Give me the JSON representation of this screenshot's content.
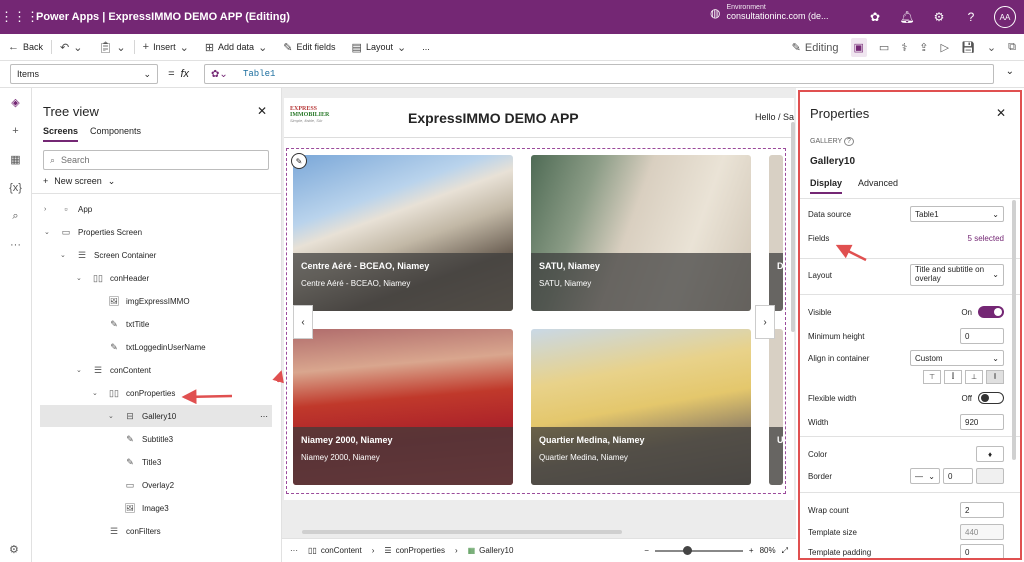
{
  "topbar": {
    "title": "Power Apps | ExpressIMMO DEMO APP (Editing)",
    "env_label": "Environment",
    "env_name": "consultationinc.com (de...",
    "avatar": "AA"
  },
  "cmdbar": {
    "back": "Back",
    "insert": "Insert",
    "add_data": "Add data",
    "edit_fields": "Edit fields",
    "layout": "Layout",
    "more": "...",
    "editing": "Editing"
  },
  "formula": {
    "property": "Items",
    "fx": "fx",
    "value": "Table1"
  },
  "tree": {
    "title": "Tree view",
    "tabs": [
      "Screens",
      "Components"
    ],
    "search_placeholder": "Search",
    "new_screen": "New screen",
    "nodes": [
      {
        "label": "App"
      },
      {
        "label": "Properties Screen"
      },
      {
        "label": "Screen Container"
      },
      {
        "label": "conHeader"
      },
      {
        "label": "imgExpressIMMO"
      },
      {
        "label": "txtTitle"
      },
      {
        "label": "txtLoggedinUserName"
      },
      {
        "label": "conContent"
      },
      {
        "label": "conProperties"
      },
      {
        "label": "Gallery10"
      },
      {
        "label": "Subtitle3"
      },
      {
        "label": "Title3"
      },
      {
        "label": "Overlay2"
      },
      {
        "label": "Image3"
      },
      {
        "label": "conFilters"
      }
    ]
  },
  "canvas": {
    "logo_line1": "EXPRESS",
    "logo_line2": "IMMOBILIER",
    "logo_tagline": "Simple, fiable, Sûr",
    "app_title": "ExpressIMMO DEMO APP",
    "hello": "Hello / Sa",
    "cards": [
      {
        "title": "Centre Aéré - BCEAO, Niamey",
        "subtitle": "Centre Aéré - BCEAO, Niamey"
      },
      {
        "title": "SATU, Niamey",
        "subtitle": "SATU, Niamey"
      },
      {
        "title": "Niamey 2000, Niamey",
        "subtitle": "Niamey 2000, Niamey"
      },
      {
        "title": "Quartier Medina, Niamey",
        "subtitle": "Quartier Medina, Niamey"
      }
    ],
    "peek_letters": [
      "D",
      "U"
    ]
  },
  "status": {
    "crumbs": [
      "conContent",
      "conProperties",
      "Gallery10"
    ],
    "zoom": "80%",
    "zoom_value": 0.8
  },
  "props": {
    "title": "Properties",
    "type": "GALLERY",
    "name": "Gallery10",
    "tabs": [
      "Display",
      "Advanced"
    ],
    "data_source_label": "Data source",
    "data_source": "Table1",
    "fields_label": "Fields",
    "fields_value": "5 selected",
    "layout_label": "Layout",
    "layout_value": "Title and subtitle on overlay",
    "visible_label": "Visible",
    "visible_value": "On",
    "min_height_label": "Minimum height",
    "min_height": "0",
    "align_label": "Align in container",
    "align_value": "Custom",
    "flex_width_label": "Flexible width",
    "flex_width_value": "Off",
    "width_label": "Width",
    "width": "920",
    "color_label": "Color",
    "border_label": "Border",
    "border_value": "0",
    "wrap_label": "Wrap count",
    "wrap": "2",
    "template_size_label": "Template size",
    "template_size": "440",
    "template_padding_label": "Template padding",
    "template_padding": "0"
  },
  "colors": {
    "brand": "#742774",
    "annotation": "#e05050"
  }
}
